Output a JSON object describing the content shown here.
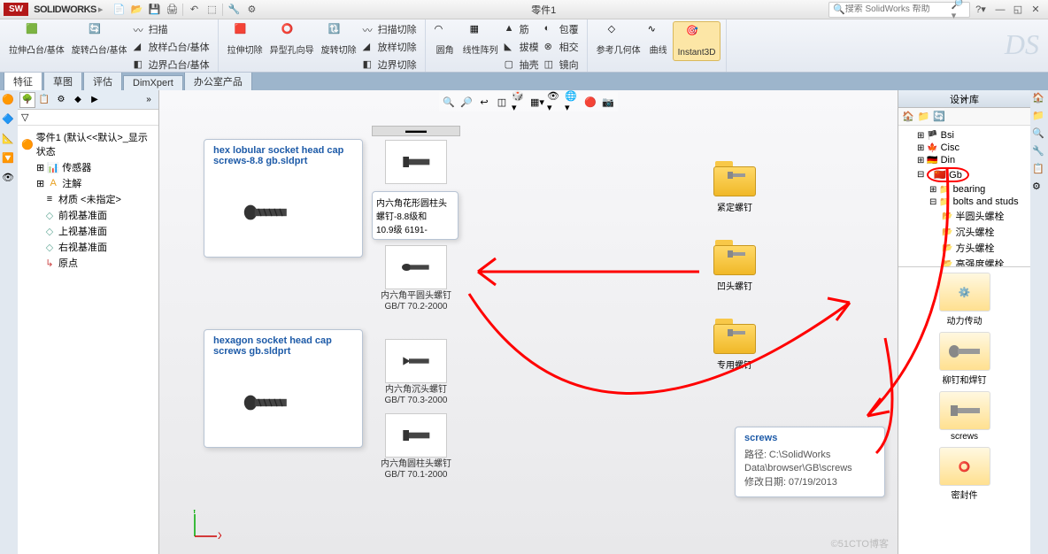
{
  "app": {
    "name": "SOLIDWORKS",
    "doc_title": "零件1"
  },
  "search": {
    "placeholder": "搜索 SolidWorks 帮助"
  },
  "ribbon": {
    "btn1": "拉伸凸台/基体",
    "btn2": "旋转凸台/基体",
    "scan": "扫描",
    "loft": "放样凸台/基体",
    "boundary": "边界凸台/基体",
    "cut1": "拉伸切除",
    "cut2": "异型孔向导",
    "cut3": "旋转切除",
    "cutscan": "扫描切除",
    "cutloft": "放样切除",
    "cutboundary": "边界切除",
    "fillet": "圆角",
    "linear": "线性阵列",
    "rib": "筋",
    "wrap": "包覆",
    "draft": "拔模",
    "inter": "相交",
    "shell": "抽壳",
    "mirror": "镜向",
    "refgeo": "参考几何体",
    "curves": "曲线",
    "instant3d": "Instant3D"
  },
  "tabs": {
    "feature": "特征",
    "sketch": "草图",
    "eval": "评估",
    "dimxpert": "DimXpert",
    "office": "办公室产品"
  },
  "tree": {
    "root": "零件1  (默认<<默认>_显示状态",
    "sensors": "传感器",
    "annot": "注解",
    "material": "材质 <未指定>",
    "front": "前视基准面",
    "top": "上视基准面",
    "right": "右视基准面",
    "origin": "原点"
  },
  "cards": {
    "c1_title": "hex lobular socket head cap screws-8.8 gb.sldprt",
    "c2_title": "hexagon socket head cap screws gb.sldprt",
    "popup1_l1": "内六角花形圆柱头",
    "popup1_l2": "螺钉-8.8级和",
    "popup1_l3": "10.9级 6191-"
  },
  "browser": {
    "i1": "内六角平圆头螺钉",
    "i1b": "GB/T 70.2-2000",
    "i2": "内六角沉头螺钉",
    "i2b": "GB/T 70.3-2000",
    "i3": "内六角圆柱头螺钉",
    "i3b": "GB/T 70.1-2000"
  },
  "folders": {
    "f1": "紧定螺钉",
    "f2": "凹头螺钉",
    "f3": "专用螺钉"
  },
  "tooltip": {
    "title": "screws",
    "path_label": "路径:",
    "path": "C:\\SolidWorks Data\\browser\\GB\\screws",
    "date_label": "修改日期:",
    "date": "07/19/2013"
  },
  "rightpanel": {
    "title": "设计库",
    "tree": {
      "bsi": "Bsi",
      "cisc": "Cisc",
      "din": "Din",
      "gb": "Gb",
      "bearing": "bearing",
      "bolts": "bolts and studs",
      "b1": "半圆头螺栓",
      "b2": "沉头螺栓",
      "b3": "方头螺栓",
      "b4": "高强度螺栓"
    },
    "grid": {
      "g1": "动力传动",
      "g2": "柳钉和焊钉",
      "g3": "screws",
      "g4": "密封件"
    }
  },
  "watermark": "©51CTO博客"
}
